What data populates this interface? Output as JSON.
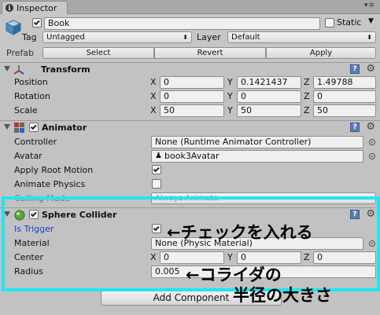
{
  "window": {
    "tab_label": "Inspector"
  },
  "header": {
    "object_name": "Book",
    "static_label": "Static",
    "tag_label": "Tag",
    "tag_value": "Untagged",
    "layer_label": "Layer",
    "layer_value": "Default",
    "prefab_label": "Prefab",
    "prefab_buttons": [
      "Select",
      "Revert",
      "Apply"
    ]
  },
  "transform": {
    "title": "Transform",
    "rows": [
      {
        "label": "Position",
        "x": "0",
        "y": "0.1421437",
        "z": "1.49788"
      },
      {
        "label": "Rotation",
        "x": "0",
        "y": "0",
        "z": "0"
      },
      {
        "label": "Scale",
        "x": "50",
        "y": "50",
        "z": "50"
      }
    ],
    "axes": [
      "X",
      "Y",
      "Z"
    ]
  },
  "animator": {
    "title": "Animator",
    "controller_label": "Controller",
    "controller_value": "None (Runtime Animator Controller)",
    "avatar_label": "Avatar",
    "avatar_value": "book3Avatar",
    "apply_root_motion_label": "Apply Root Motion",
    "animate_physics_label": "Animate Physics",
    "culling_mode_label": "Culling Mode",
    "culling_mode_value": "Always Animate"
  },
  "sphere_collider": {
    "title": "Sphere Collider",
    "is_trigger_label": "Is Trigger",
    "material_label": "Material",
    "material_value": "None (Physic Material)",
    "center_label": "Center",
    "center": {
      "x": "0",
      "y": "0",
      "z": "0"
    },
    "radius_label": "Radius",
    "radius_value": "0.005"
  },
  "add_component_label": "Add Component",
  "annotations": {
    "check_note": "←チェックを入れる",
    "radius_note_line1": "←コライダの",
    "radius_note_line2": "半径の大きさ"
  },
  "colors": {
    "highlight": "#1fe6f0",
    "is_trigger_label": "#1a3fd0"
  }
}
